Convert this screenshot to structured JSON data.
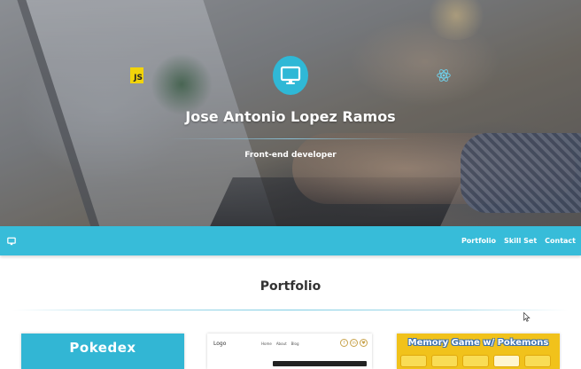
{
  "hero": {
    "name": "Jose Antonio Lopez Ramos",
    "role": "Front-end developer",
    "js_badge": "JS",
    "icons": [
      "js-logo-icon",
      "monitor-icon",
      "react-logo-icon"
    ]
  },
  "nav": {
    "logo_icon": "monitor-icon",
    "links": [
      {
        "label": "Portfolio"
      },
      {
        "label": "Skill Set"
      },
      {
        "label": "Contact"
      }
    ]
  },
  "portfolio": {
    "title": "Portfolio",
    "projects": [
      {
        "title": "Pokedex"
      },
      {
        "logo": "Logo",
        "nav": [
          "Home",
          "About",
          "Blog"
        ],
        "social": [
          "f",
          "in",
          "♥"
        ]
      },
      {
        "title": "Memory Game w/ Pokemons"
      }
    ]
  },
  "colors": {
    "accent": "#37bcd9",
    "js_yellow": "#f2d40a",
    "memory_yellow": "#f1c21b",
    "text_dark": "#333333"
  }
}
